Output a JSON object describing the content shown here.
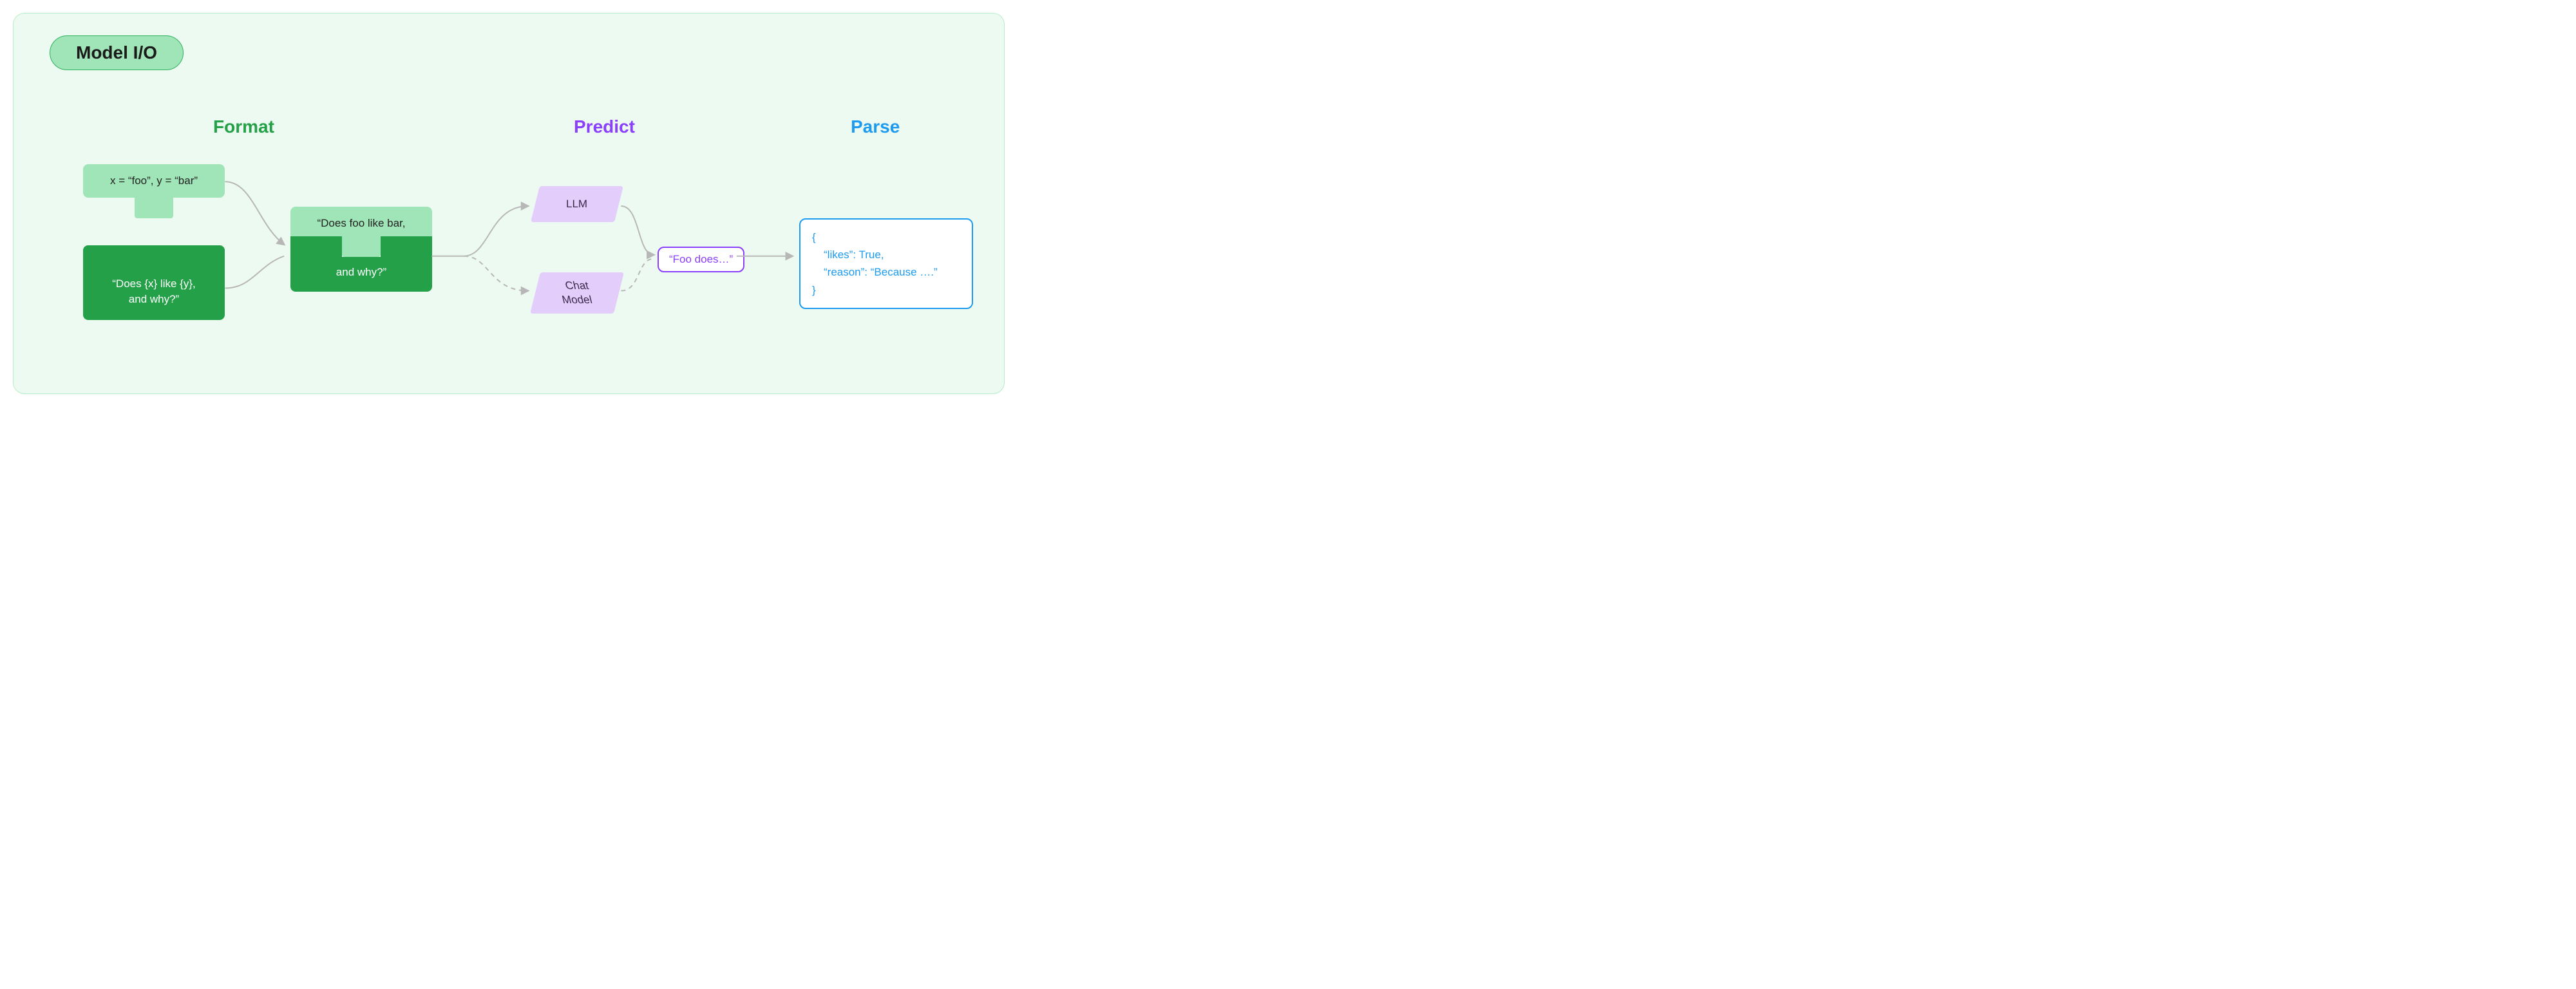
{
  "title": "Model I/O",
  "sections": {
    "format": "Format",
    "predict": "Predict",
    "parse": "Parse"
  },
  "format": {
    "vars": "x = “foo”, y = “bar”",
    "template_line1": "“Does {x} like {y},",
    "template_line2": "and why?”",
    "combined_line1": "“Does foo like bar,",
    "combined_line2": "and why?”"
  },
  "predict": {
    "llm": "LLM",
    "chat_line1": "Chat",
    "chat_line2": "Model",
    "output": "“Foo does…”"
  },
  "parse": {
    "line1": "{",
    "line2": "“likes”: True,",
    "line3": "“reason”: “Because ….”",
    "line4": "}"
  },
  "colors": {
    "panel_bg": "#edfaf1",
    "green_light": "#a0e5b7",
    "green_dark": "#24a148",
    "purple_light": "#e3cdfb",
    "purple": "#8a3ffc",
    "blue": "#1d9bf0",
    "wire": "#b7b7b7"
  }
}
